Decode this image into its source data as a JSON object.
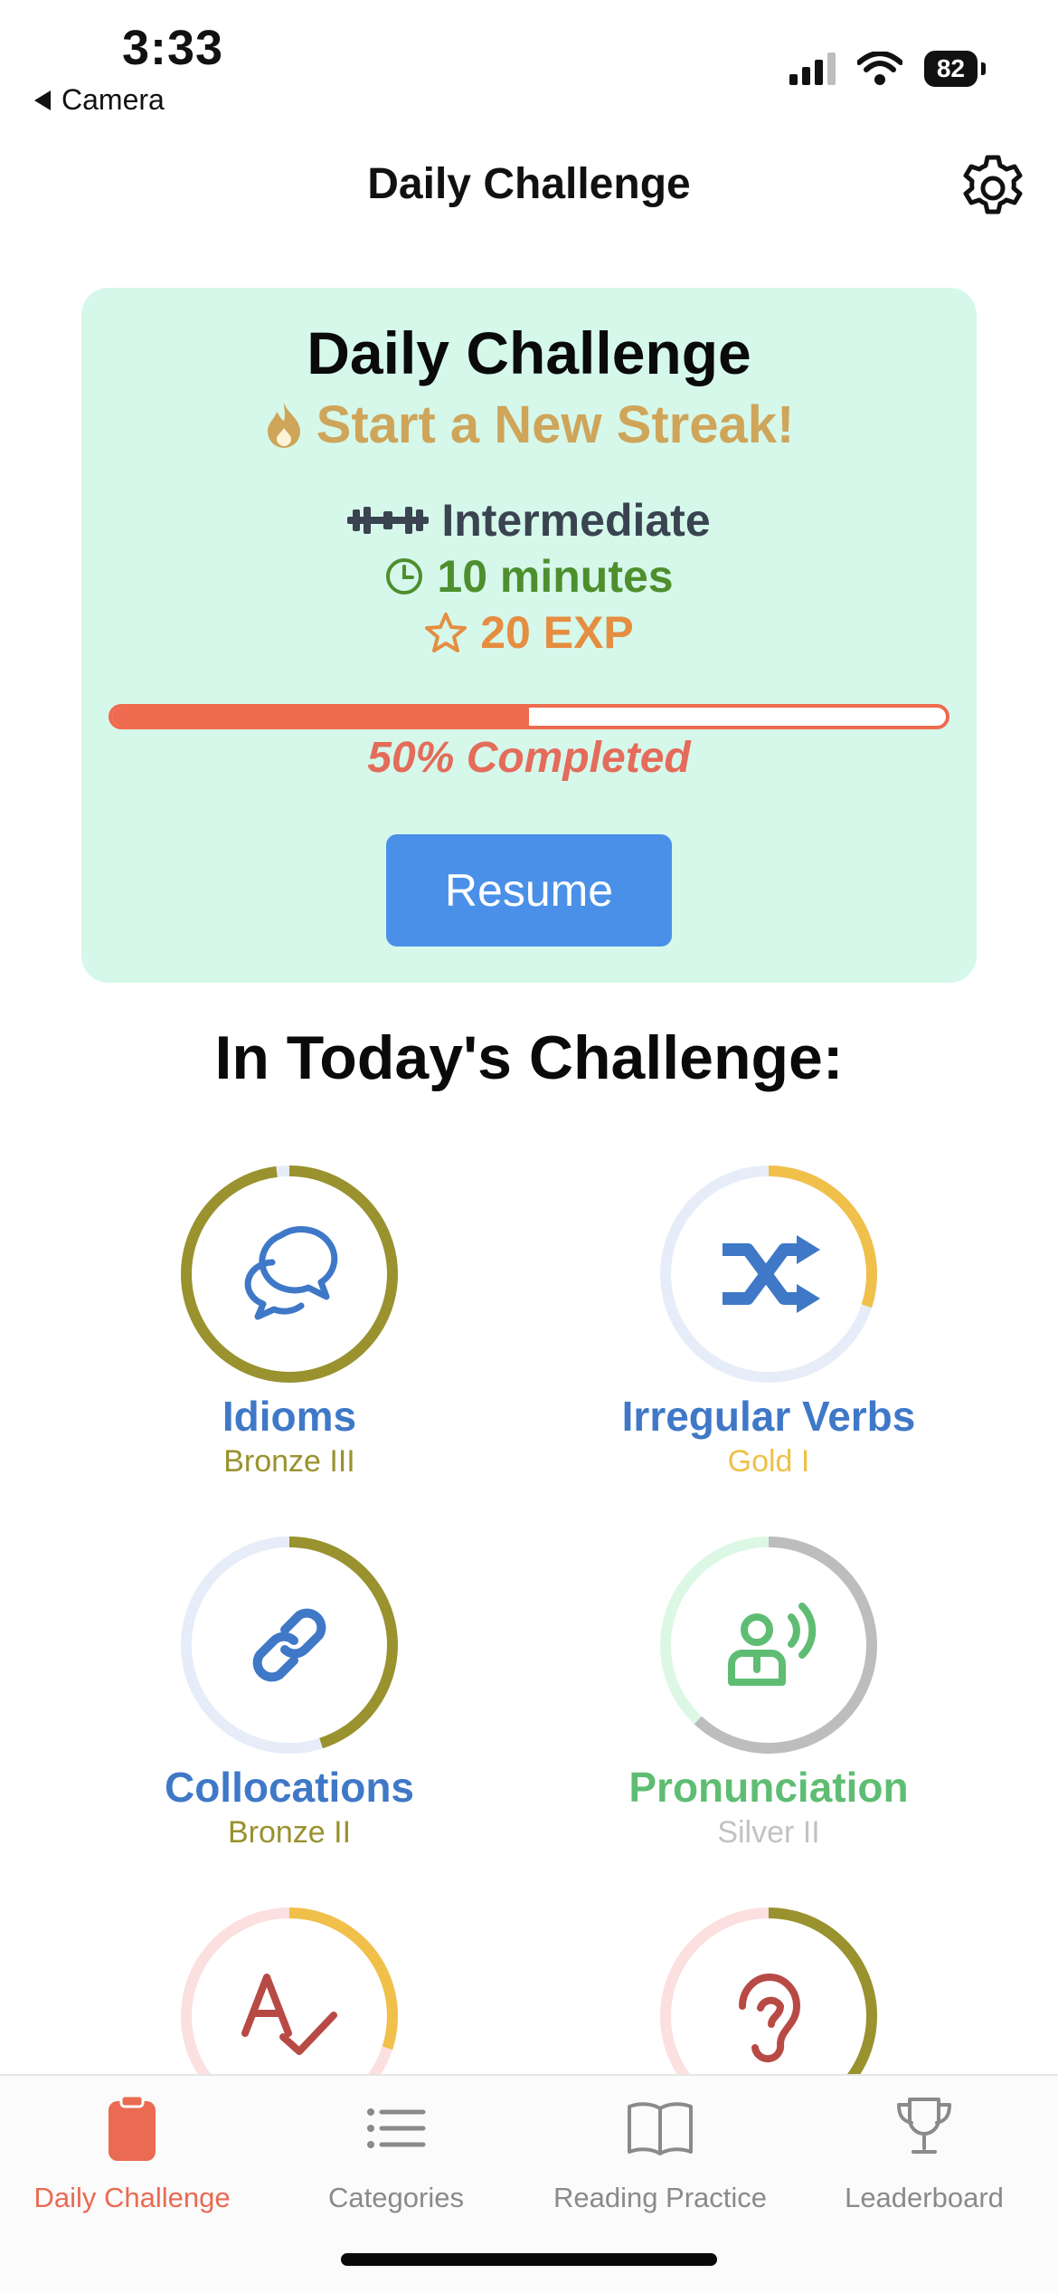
{
  "status": {
    "time": "3:33",
    "back_label": "Camera",
    "battery": "82"
  },
  "header": {
    "title": "Daily Challenge"
  },
  "card": {
    "title": "Daily Challenge",
    "streak": "Start a New Streak!",
    "level": "Intermediate",
    "duration": "10 minutes",
    "exp": "20 EXP",
    "progress_percent": 50,
    "progress_label": "50% Completed",
    "resume_label": "Resume"
  },
  "section": {
    "title": "In Today's Challenge:"
  },
  "categories": [
    {
      "name": "Idioms",
      "rank": "Bronze III",
      "progress": 0.98,
      "name_color": "#3f78c7",
      "rank_color": "#99922e",
      "ring_color": "#99922e",
      "track_color": "#e6edf9",
      "icon": "speech-bubbles-icon"
    },
    {
      "name": "Irregular Verbs",
      "rank": "Gold I",
      "progress": 0.3,
      "name_color": "#3f78c7",
      "rank_color": "#f0c04a",
      "ring_color": "#f0c04a",
      "track_color": "#e6edf9",
      "icon": "shuffle-icon"
    },
    {
      "name": "Collocations",
      "rank": "Bronze II",
      "progress": 0.45,
      "name_color": "#3f78c7",
      "rank_color": "#99922e",
      "ring_color": "#99922e",
      "track_color": "#e6edf9",
      "icon": "link-icon"
    },
    {
      "name": "Pronunciation",
      "rank": "Silver II",
      "progress": 0.62,
      "name_color": "#5fbd73",
      "rank_color": "#c2c2c2",
      "ring_color": "#bdbdbd",
      "track_color": "#dcf8e4",
      "icon": "speaking-person-icon"
    },
    {
      "name": "",
      "rank": "",
      "progress": 0.3,
      "name_color": "#b84a45",
      "rank_color": "#f0c04a",
      "ring_color": "#f0c04a",
      "track_color": "#fbe0df",
      "icon": "spell-check-icon"
    },
    {
      "name": "",
      "rank": "",
      "progress": 0.45,
      "name_color": "#b84a45",
      "rank_color": "#99922e",
      "ring_color": "#99922e",
      "track_color": "#fbe0df",
      "icon": "ear-icon"
    }
  ],
  "tabs": [
    {
      "label": "Daily Challenge",
      "icon": "clipboard-icon",
      "active": true
    },
    {
      "label": "Categories",
      "icon": "list-icon",
      "active": false
    },
    {
      "label": "Reading Practice",
      "icon": "book-icon",
      "active": false
    },
    {
      "label": "Leaderboard",
      "icon": "trophy-icon",
      "active": false
    }
  ]
}
